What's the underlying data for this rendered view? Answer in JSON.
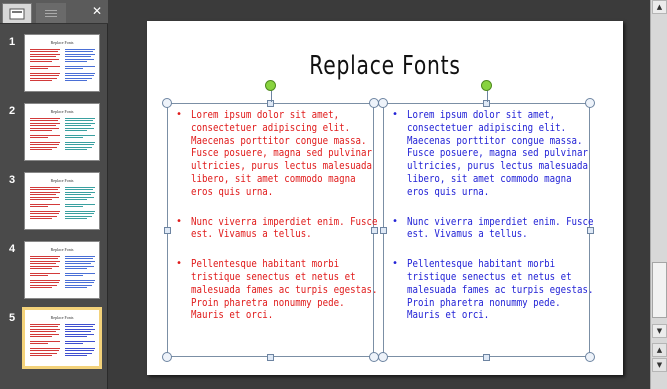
{
  "pane": {
    "close_glyph": "✕",
    "tabs": [
      {
        "name": "slides-tab",
        "icon": "slides-icon"
      },
      {
        "name": "outline-tab",
        "icon": "outline-icon"
      }
    ],
    "thumbnails": [
      {
        "number": "1",
        "title": "Replace Fonts",
        "left_color": "#d23a3a",
        "right_color": "#4a6fd6"
      },
      {
        "number": "2",
        "title": "Replace Fonts",
        "left_color": "#d23a3a",
        "right_color": "#3aa0a0"
      },
      {
        "number": "3",
        "title": "Replace Fonts",
        "left_color": "#d23a3a",
        "right_color": "#3aa0a0"
      },
      {
        "number": "4",
        "title": "Replace Fonts",
        "left_color": "#d23a3a",
        "right_color": "#4a6fd6"
      },
      {
        "number": "5",
        "title": "Replace Fonts",
        "left_color": "#d23a3a",
        "right_color": "#3f4fcf",
        "selected": true
      }
    ]
  },
  "slide": {
    "title": "Replace Fonts",
    "left_color": "#e01b1b",
    "right_color": "#2323d6",
    "left_bullets": [
      "Lorem ipsum dolor sit amet, consectetuer adipiscing elit. Maecenas porttitor congue massa. Fusce posuere, magna sed pulvinar ultricies, purus lectus malesuada libero, sit amet commodo magna eros quis urna.",
      "Nunc viverra imperdiet enim. Fusce est. Vivamus a tellus.",
      "Pellentesque habitant morbi tristique senectus et netus et malesuada fames ac turpis egestas. Proin pharetra nonummy pede. Mauris et orci."
    ],
    "right_bullets": [
      "Lorem ipsum dolor sit amet, consectetuer adipiscing elit. Maecenas porttitor congue massa. Fusce posuere, magna sed pulvinar ultricies, purus lectus malesuada libero, sit amet commodo magna eros quis urna.",
      "Nunc viverra imperdiet enim. Fusce est. Vivamus a tellus.",
      "Pellentesque habitant morbi tristique senectus et netus et malesuada fames ac turpis egestas. Proin pharetra nonummy pede. Mauris et orci."
    ],
    "bullet_glyph": "•"
  },
  "scrollbar": {
    "up_glyph": "▲",
    "down_glyph": "▼",
    "prev_slide_glyph": "▲",
    "next_slide_glyph": "▼"
  }
}
